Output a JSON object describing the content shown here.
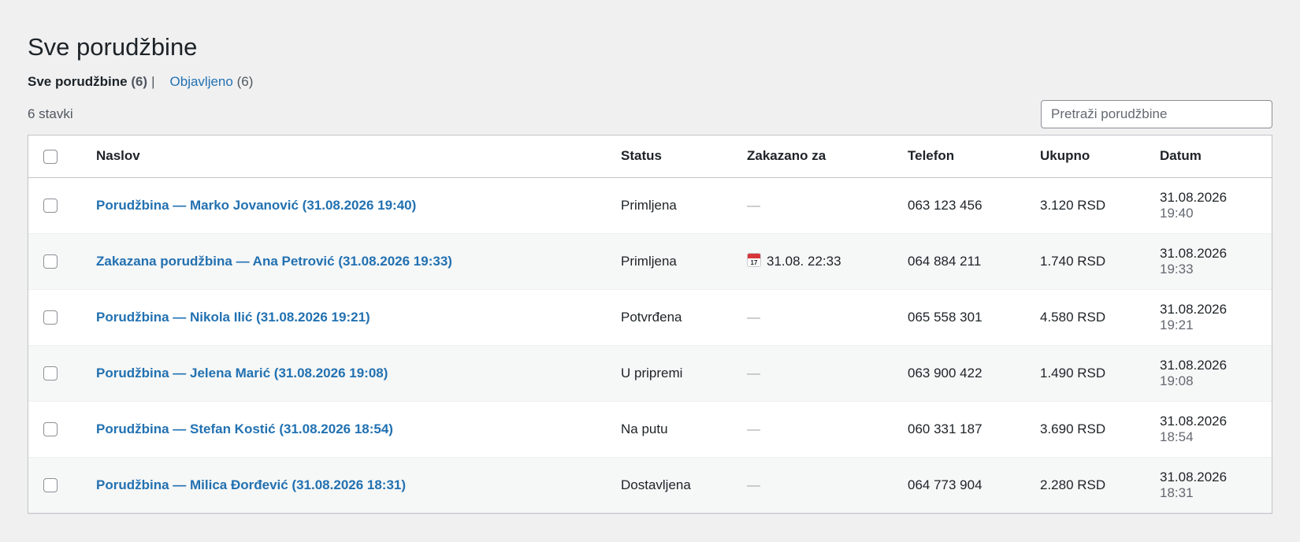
{
  "page": {
    "title": "Sve porudžbine"
  },
  "views": {
    "all_label": "Sve porudžbine",
    "all_count": "(6)",
    "separator": "|",
    "published_label": "Objavljeno",
    "published_count": "(6)"
  },
  "items_count": "6 stavki",
  "search": {
    "placeholder": "Pretraži porudžbine"
  },
  "table": {
    "headers": {
      "title": "Naslov",
      "status": "Status",
      "scheduled": "Zakazano za",
      "phone": "Telefon",
      "total": "Ukupno",
      "date": "Datum"
    },
    "rows": [
      {
        "title": "Porudžbina — Marko Jovanović (31.08.2026 19:40)",
        "status": "Primljena",
        "scheduled": "—",
        "scheduled_icon": "",
        "phone": "063 123 456",
        "total": "3.120 RSD",
        "date": "31.08.2026",
        "time": "19:40"
      },
      {
        "title": "Zakazana porudžbina — Ana Petrović (31.08.2026 19:33)",
        "status": "Primljena",
        "scheduled": "31.08. 22:33",
        "scheduled_icon": "calendar-icon",
        "phone": "064 884 211",
        "total": "1.740 RSD",
        "date": "31.08.2026",
        "time": "19:33"
      },
      {
        "title": "Porudžbina — Nikola Ilić (31.08.2026 19:21)",
        "status": "Potvrđena",
        "scheduled": "—",
        "scheduled_icon": "",
        "phone": "065 558 301",
        "total": "4.580 RSD",
        "date": "31.08.2026",
        "time": "19:21"
      },
      {
        "title": "Porudžbina — Jelena Marić (31.08.2026 19:08)",
        "status": "U pripremi",
        "scheduled": "—",
        "scheduled_icon": "",
        "phone": "063 900 422",
        "total": "1.490 RSD",
        "date": "31.08.2026",
        "time": "19:08"
      },
      {
        "title": "Porudžbina — Stefan Kostić (31.08.2026 18:54)",
        "status": "Na putu",
        "scheduled": "—",
        "scheduled_icon": "",
        "phone": "060 331 187",
        "total": "3.690 RSD",
        "date": "31.08.2026",
        "time": "18:54"
      },
      {
        "title": "Porudžbina — Milica Đorđević (31.08.2026 18:31)",
        "status": "Dostavljena",
        "scheduled": "—",
        "scheduled_icon": "",
        "phone": "064 773 904",
        "total": "2.280 RSD",
        "date": "31.08.2026",
        "time": "18:31"
      }
    ]
  },
  "colors": {
    "link": "#2271b1",
    "background": "#f0f0f1",
    "row_alt": "#f6f7f7"
  }
}
